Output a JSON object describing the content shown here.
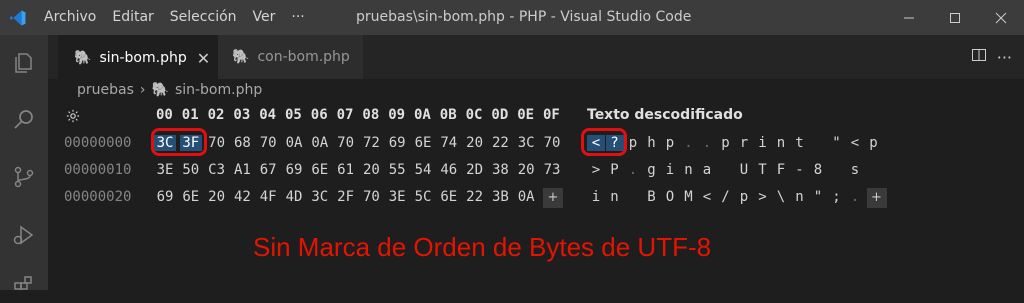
{
  "titlebar": {
    "menu": [
      {
        "label": "Archivo"
      },
      {
        "label": "Editar"
      },
      {
        "label": "Selección"
      },
      {
        "label": "Ver"
      },
      {
        "label": "···"
      }
    ],
    "window_title": "pruebas\\sin-bom.php - PHP - Visual Studio Code"
  },
  "tabs": [
    {
      "label": "sin-bom.php",
      "active": true
    },
    {
      "label": "con-bom.php",
      "active": false
    }
  ],
  "breadcrumb": {
    "folder": "pruebas",
    "file": "sin-bom.php"
  },
  "hex": {
    "columns": [
      "00",
      "01",
      "02",
      "03",
      "04",
      "05",
      "06",
      "07",
      "08",
      "09",
      "0A",
      "0B",
      "0C",
      "0D",
      "0E",
      "0F"
    ],
    "decoded_header": "Texto descodificado",
    "rows": [
      {
        "address": "00000000",
        "bytes": [
          "3C",
          "3F",
          "70",
          "68",
          "70",
          "0A",
          "0A",
          "70",
          "72",
          "69",
          "6E",
          "74",
          "20",
          "22",
          "3C",
          "70"
        ],
        "chars": [
          "<",
          "?",
          "p",
          "h",
          "p",
          ".",
          ".",
          "p",
          "r",
          "i",
          "n",
          "t",
          " ",
          "\"",
          "<",
          "p"
        ]
      },
      {
        "address": "00000010",
        "bytes": [
          "3E",
          "50",
          "C3",
          "A1",
          "67",
          "69",
          "6E",
          "61",
          "20",
          "55",
          "54",
          "46",
          "2D",
          "38",
          "20",
          "73"
        ],
        "chars": [
          ">",
          "P",
          ".",
          "g",
          "i",
          "n",
          "a",
          " ",
          "U",
          "T",
          "F",
          "-",
          "8",
          " ",
          "s",
          ""
        ]
      },
      {
        "address": "00000020",
        "bytes": [
          "69",
          "6E",
          "20",
          "42",
          "4F",
          "4D",
          "3C",
          "2F",
          "70",
          "3E",
          "5C",
          "6E",
          "22",
          "3B",
          "0A",
          "+"
        ],
        "chars": [
          "i",
          "n",
          " ",
          "B",
          "O",
          "M",
          "<",
          "/",
          "p",
          ">",
          "\\",
          "n",
          "\"",
          ";",
          ".",
          "+"
        ]
      }
    ]
  },
  "caption": "Sin Marca de Orden de Bytes de UTF-8",
  "colors": {
    "accent": "#264f78",
    "highlight_ring": "#e01010",
    "caption": "#e51400"
  }
}
